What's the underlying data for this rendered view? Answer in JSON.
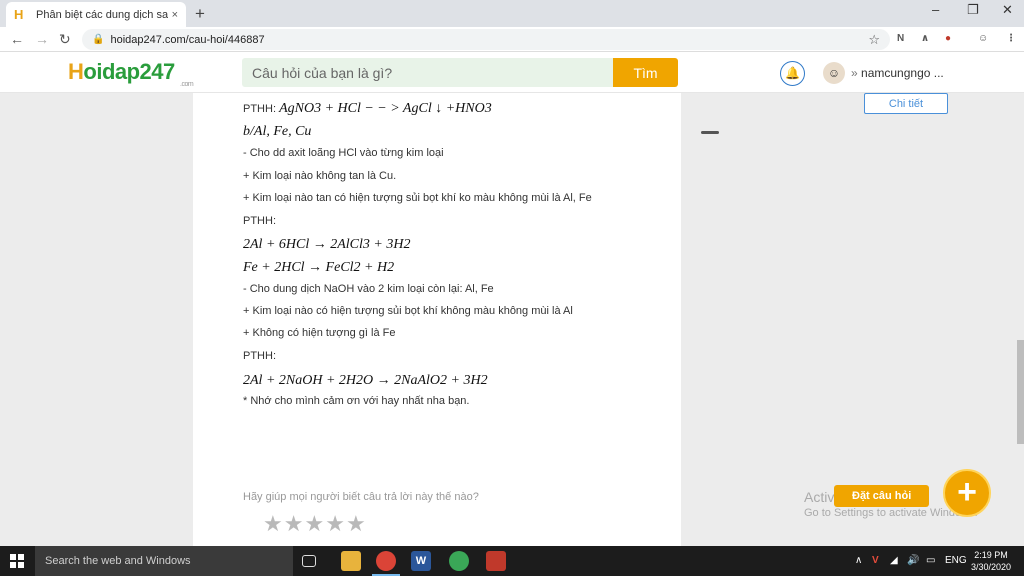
{
  "browser": {
    "tab_title": "Phân biệt các dung dịch sau bằn",
    "tab_close": "×",
    "new_tab": "+",
    "url": "hoidap247.com/cau-hoi/446887",
    "controls": {
      "minimize": "–",
      "restore": "❐",
      "close": "✕"
    },
    "nav": {
      "back": "←",
      "forward": "→",
      "reload": "↻"
    }
  },
  "site": {
    "logo_h": "H",
    "logo_rest": "oidap247",
    "logo_sub": ".com",
    "search_placeholder": "Câu hỏi của bạn là gì?",
    "search_button": "Tìm",
    "username": "namcungngo ...",
    "user_chevron": "»"
  },
  "answer": {
    "lines": [
      {
        "kind": "mixed",
        "prefix": "PTHH: ",
        "math": "AgNO3 + HCl − − > AgCl ↓ +HNO3"
      },
      {
        "kind": "math",
        "math": "b/Al, Fe, Cu"
      },
      {
        "kind": "text",
        "text": "- Cho dd axit loãng HCl vào từng kim loại"
      },
      {
        "kind": "text",
        "text": "+ Kim loại nào không tan là Cu."
      },
      {
        "kind": "text",
        "text": "+ Kim loại nào tan có hiện tượng sủi bọt khí ko màu không mùi là Al, Fe"
      },
      {
        "kind": "text",
        "text": "PTHH:"
      },
      {
        "kind": "math",
        "math": "2Al + 6HCl → 2AlCl3 + 3H2"
      },
      {
        "kind": "math",
        "math": "Fe + 2HCl → FeCl2 + H2"
      },
      {
        "kind": "text",
        "text": "- Cho dung dịch NaOH vào 2 kim loại còn lại: Al, Fe"
      },
      {
        "kind": "text",
        "text": "+ Kim loại nào có hiện tượng sủi bọt khí không màu không mùi là Al"
      },
      {
        "kind": "text",
        "text": "+ Không có hiện tượng gì là Fe"
      },
      {
        "kind": "text",
        "text": "PTHH:"
      },
      {
        "kind": "math",
        "math": "2Al + 2NaOH + 2H2O → 2NaAlO2 + 3H2"
      },
      {
        "kind": "text",
        "text": "* Nhớ cho mình cảm ơn với hay nhất nha bạn."
      }
    ],
    "rating_prompt": "Hãy giúp mọi người biết câu trả lời này thế nào?",
    "rating": {
      "value": 0,
      "max": 5
    }
  },
  "sidebar": {
    "detail_button": "Chi tiết",
    "activate_title": "Activate Windows",
    "activate_sub": "Go to Settings to activate Windows.",
    "ask_label": "Đặt câu hỏi",
    "ask_plus": "+"
  },
  "taskbar": {
    "search_placeholder": "Search the web and Windows",
    "language": "ENG",
    "time": "2:19 PM",
    "date": "3/30/2020"
  },
  "colors": {
    "brand_green": "#2a9d3c",
    "brand_orange": "#f0a500",
    "link_blue": "#4a90d9"
  }
}
